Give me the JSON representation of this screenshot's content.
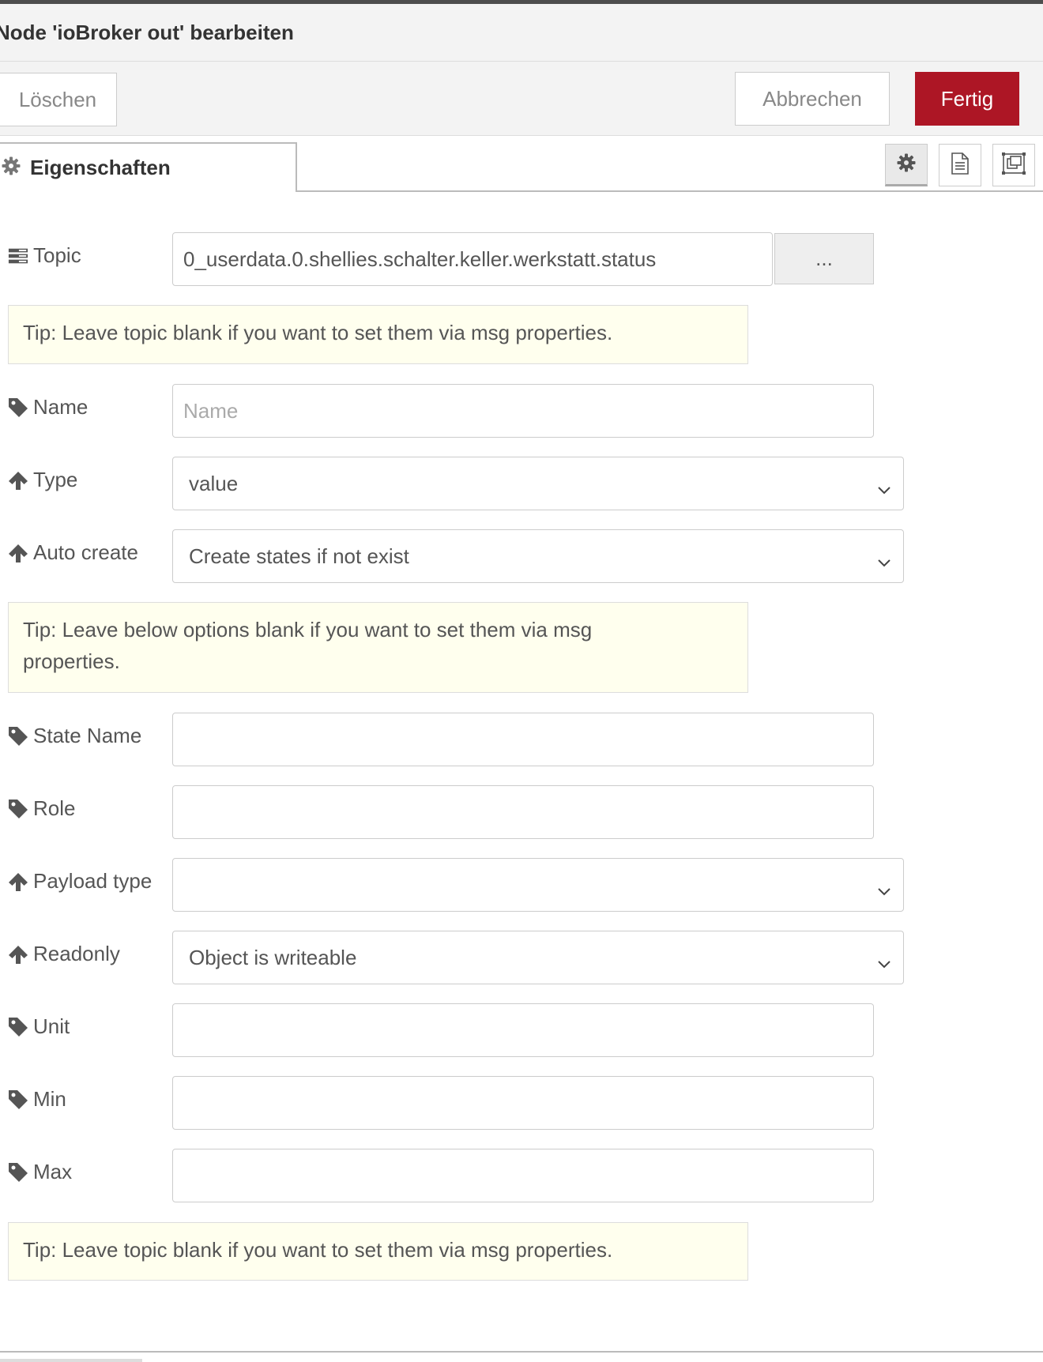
{
  "dialog": {
    "title": "Node 'ioBroker out' bearbeiten"
  },
  "toolbar": {
    "delete_label": "Löschen",
    "cancel_label": "Abbrechen",
    "done_label": "Fertig",
    "done_color": "#ad1625"
  },
  "tabs": {
    "properties_label": "Eigenschaften",
    "icons": [
      "gear-icon",
      "file-text-icon",
      "window-restore-icon"
    ]
  },
  "form": {
    "topic": {
      "label": "Topic",
      "icon": "tasks-icon",
      "value": "0_userdata.0.shellies.schalter.keller.werkstatt.status",
      "browse_label": "..."
    },
    "tip1": "Tip: Leave topic blank if you want to set them via msg properties.",
    "name": {
      "label": "Name",
      "icon": "tag-icon",
      "value": "",
      "placeholder": "Name"
    },
    "type": {
      "label": "Type",
      "icon": "arrow-up-icon",
      "selected": "value"
    },
    "auto_create": {
      "label": "Auto create",
      "icon": "arrow-up-icon",
      "selected": "Create states if not exist"
    },
    "tip2": "Tip: Leave below options blank if you want to set them via msg properties.",
    "state_name": {
      "label": "State Name",
      "icon": "tag-icon",
      "value": ""
    },
    "role": {
      "label": "Role",
      "icon": "tag-icon",
      "value": ""
    },
    "payload_type": {
      "label": "Payload type",
      "icon": "arrow-up-icon",
      "selected": ""
    },
    "readonly": {
      "label": "Readonly",
      "icon": "arrow-up-icon",
      "selected": "Object is writeable"
    },
    "unit": {
      "label": "Unit",
      "icon": "tag-icon",
      "value": ""
    },
    "min": {
      "label": "Min",
      "icon": "tag-icon",
      "value": ""
    },
    "max": {
      "label": "Max",
      "icon": "tag-icon",
      "value": ""
    },
    "tip3": "Tip: Leave topic blank if you want to set them via msg properties."
  }
}
